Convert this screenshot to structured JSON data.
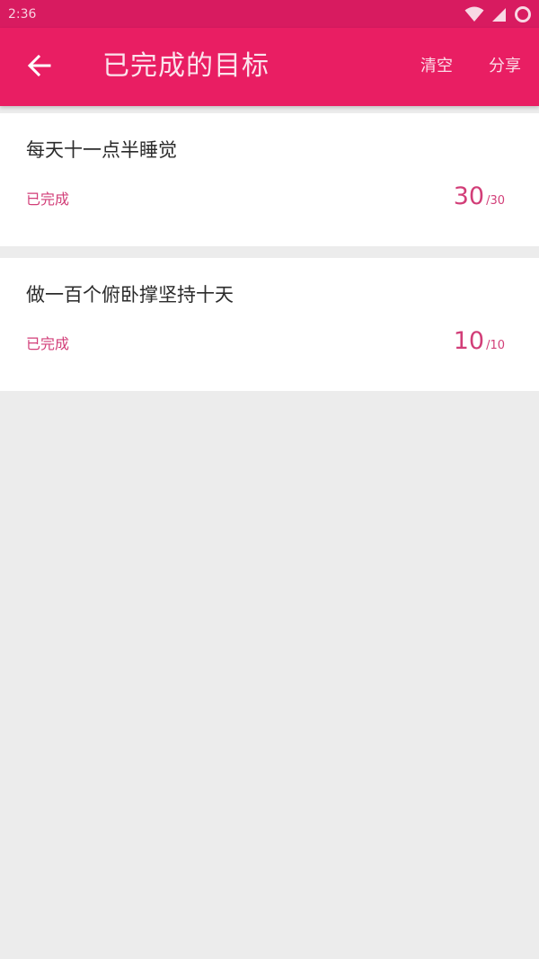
{
  "status_bar": {
    "time": "2:36",
    "icons": [
      "wifi-icon",
      "cellular-signal-icon",
      "battery-icon"
    ]
  },
  "app_bar": {
    "back_icon": "arrow-back-icon",
    "title": "已完成的目标",
    "actions": {
      "clear": "清空",
      "share": "分享"
    }
  },
  "goals": [
    {
      "title": "每天十一点半睡觉",
      "status": "已完成",
      "current": "30",
      "separator": "/",
      "total": "30"
    },
    {
      "title": "做一百个俯卧撑坚持十天",
      "status": "已完成",
      "current": "10",
      "separator": "/",
      "total": "10"
    }
  ],
  "colors": {
    "status_bar": "#D81B60",
    "app_bar": "#E91E63",
    "accent": "#D23E78",
    "background": "#ECECEC",
    "card": "#FFFFFF"
  }
}
